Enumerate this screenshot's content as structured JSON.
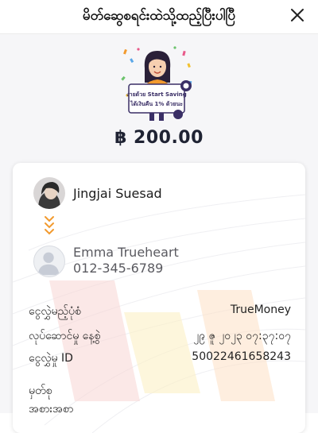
{
  "header": {
    "title": "မိတ်ဆွေစရင်းထဲသို့ထည့်ပြီးပါပြီ",
    "close_icon": "close-icon"
  },
  "illustration": {
    "banner_line1": "ง่ายด้วย Start Saving",
    "banner_line2": "ได้เงินคืน 1% ด้วยนะ"
  },
  "amount": "฿ 200.00",
  "sender": {
    "name": "Jingjai Suesad",
    "avatar_icon": "user-photo"
  },
  "transfer_icon": "chevron-double-down-icon",
  "recipient": {
    "name": "Emma Trueheart",
    "phone": "012-345-6789",
    "avatar_icon": "default-user-icon"
  },
  "details": [
    {
      "label": "ငွေလွှဲမည့်ပုံစံ",
      "value": "TrueMoney"
    },
    {
      "label": "လုပ်ဆောင်မှု နေ့စွဲ",
      "value": "၂၉ ဇူ ၂၀၂၃ ၀၇:၃၇:၀၇"
    },
    {
      "label": "ငွေလွှဲမှု ID",
      "value": "50022461658243"
    },
    {
      "label": "မှတ်စု",
      "value": ""
    },
    {
      "label": "အစားအစာ",
      "value": ""
    }
  ],
  "colors": {
    "accent_orange": "#f29a2e",
    "text_dark": "#1f2333",
    "text_muted": "#5a5a60"
  }
}
